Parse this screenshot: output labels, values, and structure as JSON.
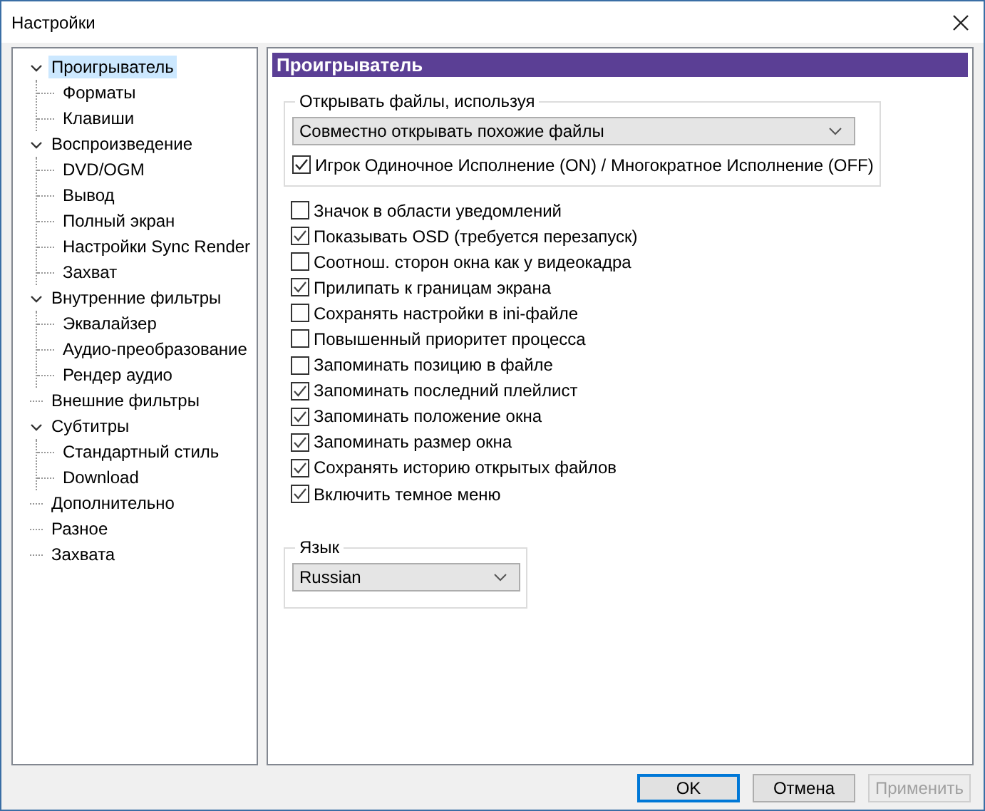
{
  "window": {
    "title": "Настройки"
  },
  "tree": [
    {
      "label": "Проигрыватель",
      "selected": true,
      "expanded": true,
      "children": [
        {
          "label": "Форматы",
          "selected": false
        },
        {
          "label": "Клавиши",
          "selected": false
        }
      ]
    },
    {
      "label": "Воспроизведение",
      "selected": false,
      "expanded": true,
      "children": [
        {
          "label": "DVD/OGM",
          "selected": false
        },
        {
          "label": "Вывод",
          "selected": false
        },
        {
          "label": "Полный экран",
          "selected": false
        },
        {
          "label": "Настройки Sync Render",
          "selected": false
        },
        {
          "label": "Захват",
          "selected": false
        }
      ]
    },
    {
      "label": "Внутренние фильтры",
      "selected": false,
      "expanded": true,
      "children": [
        {
          "label": "Эквалайзер",
          "selected": false
        },
        {
          "label": "Аудио-преобразование",
          "selected": false
        },
        {
          "label": "Рендер аудио",
          "selected": false
        }
      ]
    },
    {
      "label": "Внешние фильтры",
      "selected": false
    },
    {
      "label": "Субтитры",
      "selected": false,
      "expanded": true,
      "children": [
        {
          "label": "Стандартный стиль",
          "selected": false
        },
        {
          "label": "Download",
          "selected": false
        }
      ]
    },
    {
      "label": "Дополнительно",
      "selected": false
    },
    {
      "label": "Разное",
      "selected": false
    },
    {
      "label": "Захвата",
      "selected": false
    }
  ],
  "panel": {
    "title": "Проигрыватель",
    "open_group": {
      "legend": "Открывать файлы, используя",
      "dropdown": "Совместно открывать похожие файлы",
      "checkbox": {
        "label": "Игрок Одиночное Исполнение (ON) / Многократное Исполнение (OFF)",
        "checked": true
      }
    },
    "options": [
      {
        "label": "Значок в области уведомлений",
        "checked": false
      },
      {
        "label": "Показывать OSD (требуется перезапуск)",
        "checked": true
      },
      {
        "label": "Соотнош. сторон окна как у видеокадра",
        "checked": false
      },
      {
        "label": "Прилипать к границам экрана",
        "checked": true
      },
      {
        "label": "Сохранять настройки в ini-файле",
        "checked": false
      },
      {
        "label": "Повышенный приоритет процесса",
        "checked": false
      },
      {
        "label": "Запоминать позицию в файле",
        "checked": false
      },
      {
        "label": "Запоминать последний плейлист",
        "checked": true
      },
      {
        "label": "Запоминать положение окна",
        "checked": true
      },
      {
        "label": "Запоминать размер окна",
        "checked": true
      },
      {
        "label": "Сохранять историю открытых файлов",
        "checked": true
      },
      {
        "label": "Включить темное меню",
        "checked": true
      }
    ],
    "language_group": {
      "legend": "Язык",
      "dropdown": "Russian"
    }
  },
  "buttons": [
    {
      "label": "OK",
      "default": true,
      "disabled": false
    },
    {
      "label": "Отмена",
      "default": false,
      "disabled": false
    },
    {
      "label": "Применить",
      "default": false,
      "disabled": true
    }
  ]
}
